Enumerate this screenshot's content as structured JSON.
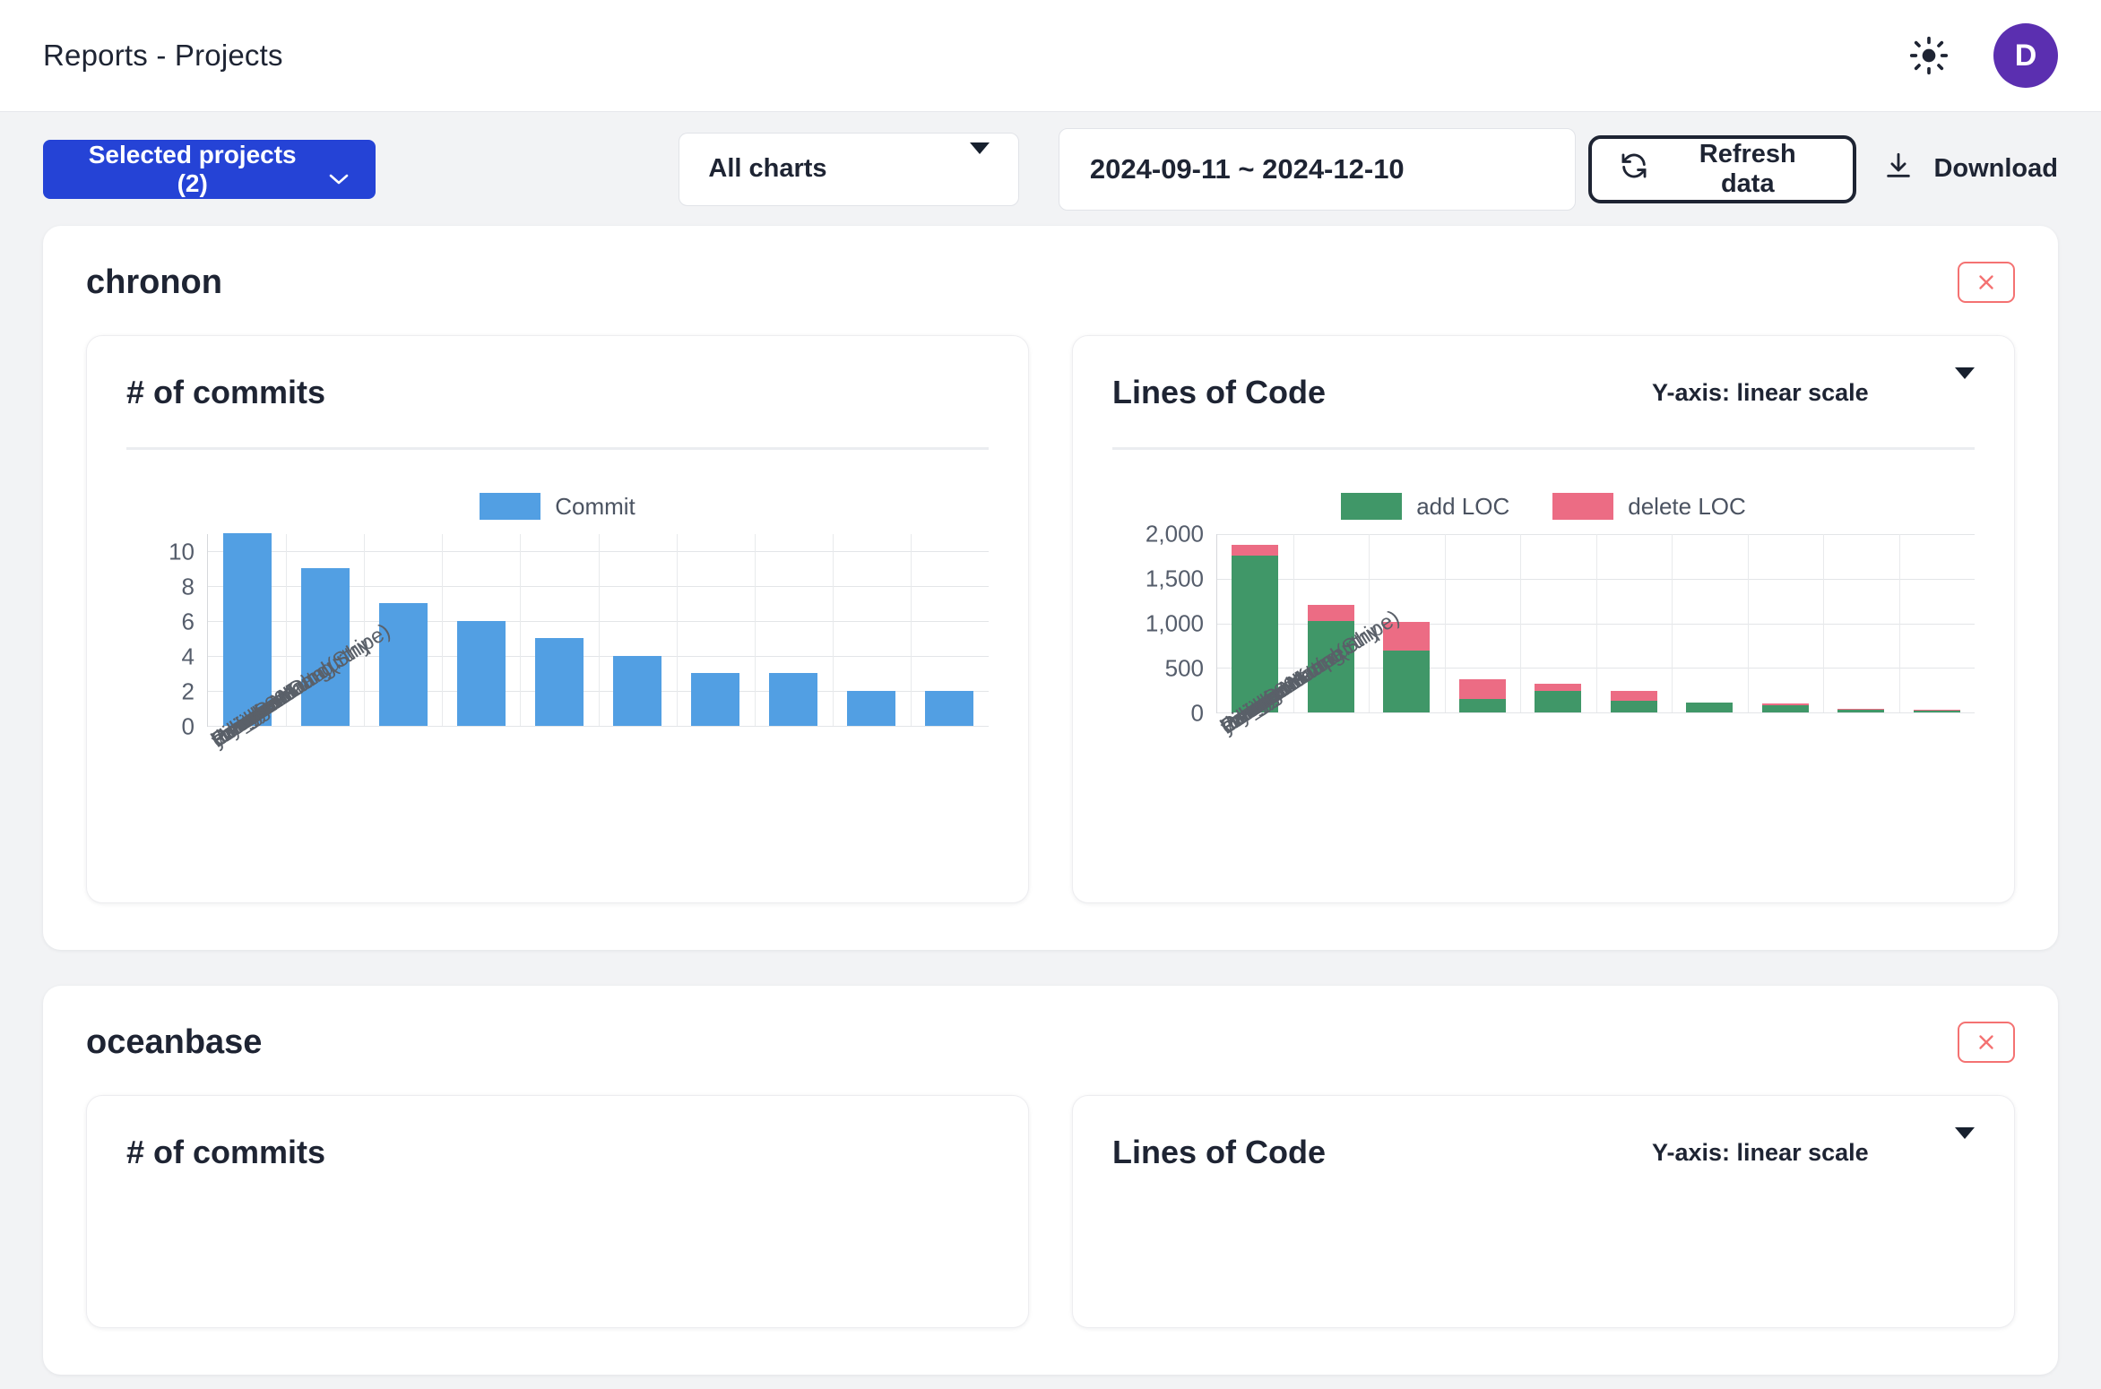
{
  "header": {
    "title": "Reports - Projects",
    "theme_toggle_icon": "sun-icon",
    "avatar_initial": "D",
    "avatar_color": "#5b2fb0"
  },
  "toolbar": {
    "selected_projects_label": "Selected projects (2)",
    "selected_projects_color": "#2543d6",
    "charts_filter_value": "All charts",
    "date_range_value": "2024-09-11 ~ 2024-12-10",
    "refresh_label": "Refresh data",
    "download_label": "Download"
  },
  "projects": [
    {
      "name": "chronon",
      "close_label": "×"
    },
    {
      "name": "oceanbase",
      "close_label": "×"
    }
  ],
  "chart_labels": {
    "commits_title": "# of commits",
    "loc_title": "Lines of Code",
    "yaxis_scale_value": "Y-axis: linear scale"
  },
  "colors": {
    "commit_blue": "#529fe3",
    "add_loc_green": "#409768",
    "delete_loc_pink": "#ec6c84",
    "close_red": "#f47272",
    "page_bg": "#f2f3f5"
  },
  "chart_data": [
    {
      "id": "chronon-commits",
      "project": "chronon",
      "type": "bar",
      "title": "# of commits",
      "xlabel": "",
      "ylabel": "",
      "ylim": [
        0,
        11
      ],
      "yticks": [
        0,
        2,
        4,
        6,
        8,
        10
      ],
      "grid": true,
      "legend": [
        "Commit"
      ],
      "legend_position": "top-center",
      "categories": [
        "yuli-han",
        "Pengyu Hou",
        "hzding621",
        "Haozhen Ding",
        "yuli_han",
        "rohitgirme",
        "Praveen Kundurthy",
        "Piyush Narang",
        "Caio Camatta (Stripe)",
        "donghanz"
      ],
      "series": [
        {
          "name": "Commit",
          "color": "#529fe3",
          "values": [
            11,
            9,
            7,
            6,
            5,
            4,
            3,
            3,
            2,
            2
          ]
        }
      ]
    },
    {
      "id": "chronon-loc",
      "project": "chronon",
      "type": "bar",
      "stacked": true,
      "title": "Lines of Code",
      "xlabel": "",
      "ylabel": "",
      "ylim": [
        0,
        2000
      ],
      "yticks": [
        0,
        500,
        1000,
        1500,
        2000
      ],
      "ytick_labels": [
        "0",
        "500",
        "1,000",
        "1,500",
        "2,000"
      ],
      "grid": true,
      "scale": "linear",
      "legend": [
        "add LOC",
        "delete LOC"
      ],
      "legend_position": "top-center",
      "categories": [
        "Piyush Narang",
        "yuli-han",
        "Pengyu Hou",
        "hzding621",
        "Praveen Kundurthy",
        "rohitgirme",
        "earangol-stripe",
        "Caio Camatta (Stripe)",
        "donghanz",
        "yuli_han"
      ],
      "series": [
        {
          "name": "add LOC",
          "color": "#409768",
          "values": [
            1750,
            1020,
            690,
            155,
            245,
            135,
            110,
            85,
            30,
            18
          ]
        },
        {
          "name": "delete LOC",
          "color": "#ec6c84",
          "values": [
            120,
            180,
            320,
            215,
            75,
            105,
            5,
            15,
            15,
            12
          ]
        }
      ]
    },
    {
      "id": "oceanbase-commits",
      "project": "oceanbase",
      "type": "bar",
      "title": "# of commits",
      "categories": [],
      "series": []
    },
    {
      "id": "oceanbase-loc",
      "project": "oceanbase",
      "type": "bar",
      "stacked": true,
      "title": "Lines of Code",
      "categories": [],
      "series": []
    }
  ]
}
